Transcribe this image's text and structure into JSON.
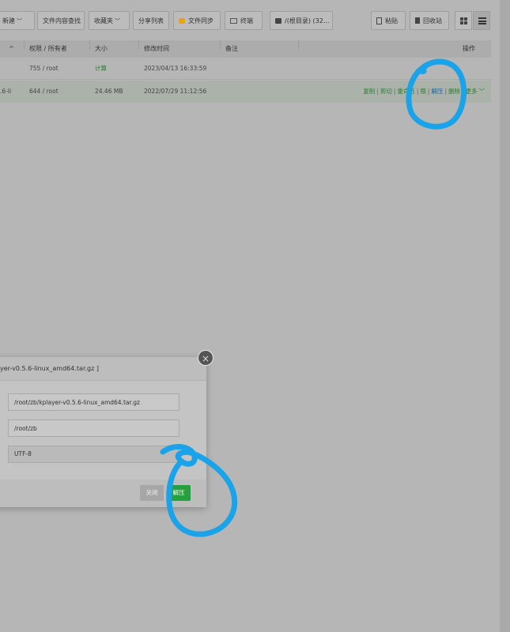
{
  "toolbar": {
    "new": "新建",
    "content_search": "文件内容查找",
    "favorites": "收藏夹",
    "share_list": "分享列表",
    "file_sync": "文件同步",
    "terminal": "终端",
    "root_disk": "/(根目录) (32...",
    "paste": "粘贴",
    "recycle_bin": "回收站"
  },
  "table": {
    "headers": {
      "sort": "^",
      "perm_owner": "权限 / 所有者",
      "size": "大小",
      "mtime": "修改时间",
      "remark": "备注",
      "ops": "操作"
    },
    "rows": [
      {
        "name": "",
        "perm": "755 / root",
        "size": "计算",
        "mtime": "2023/04/13 16:33:59"
      },
      {
        "name": ".6-li",
        "perm": "644 / root",
        "size": "24.46 MB",
        "mtime": "2022/07/29 11:12:56"
      }
    ],
    "row_actions": {
      "copy": "复制",
      "cut": "剪切",
      "rename": "重命名",
      "perm": "限",
      "extract": "解压",
      "delete": "删除",
      "more": "更多"
    }
  },
  "dialog": {
    "title": "yer-v0.5.6-linux_amd64.tar.gz ]",
    "source_path": "/root/zb/kplayer-v0.5.6-linux_amd64.tar.gz",
    "target_dir": "/root/zb",
    "encoding": "UTF-8",
    "close_label": "关闭",
    "extract_label": "解压"
  },
  "colors": {
    "accent_green": "#23a13d",
    "annotation_blue": "#1aa3e8"
  }
}
